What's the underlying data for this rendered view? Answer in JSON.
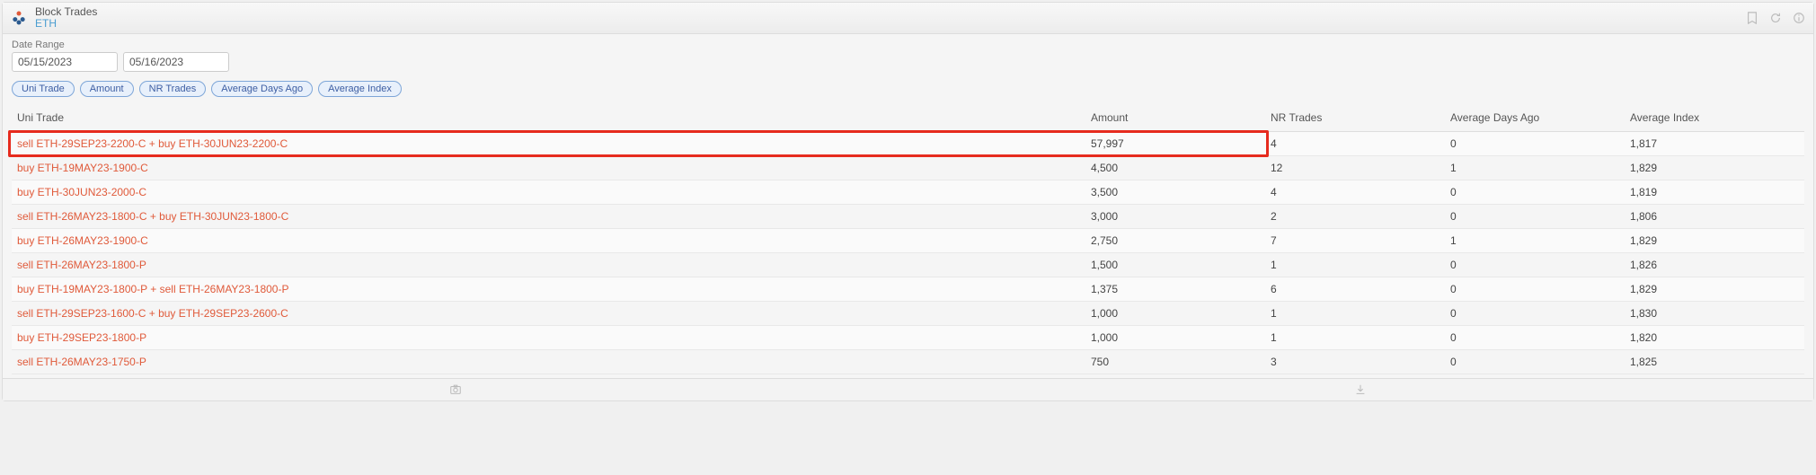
{
  "header": {
    "title": "Block Trades",
    "subtitle": "ETH"
  },
  "date_range": {
    "label": "Date Range",
    "from": "05/15/2023",
    "to": "05/16/2023"
  },
  "chips": [
    "Uni Trade",
    "Amount",
    "NR Trades",
    "Average Days Ago",
    "Average Index"
  ],
  "columns": {
    "c0": "Uni Trade",
    "c1": "Amount",
    "c2": "NR Trades",
    "c3": "Average Days Ago",
    "c4": "Average Index"
  },
  "rows": [
    {
      "trade": "sell ETH-29SEP23-2200-C + buy ETH-30JUN23-2200-C",
      "amount": "57,997",
      "nr": "4",
      "days": "0",
      "index": "1,817",
      "highlight": true
    },
    {
      "trade": "buy ETH-19MAY23-1900-C",
      "amount": "4,500",
      "nr": "12",
      "days": "1",
      "index": "1,829"
    },
    {
      "trade": "buy ETH-30JUN23-2000-C",
      "amount": "3,500",
      "nr": "4",
      "days": "0",
      "index": "1,819"
    },
    {
      "trade": "sell ETH-26MAY23-1800-C + buy ETH-30JUN23-1800-C",
      "amount": "3,000",
      "nr": "2",
      "days": "0",
      "index": "1,806"
    },
    {
      "trade": "buy ETH-26MAY23-1900-C",
      "amount": "2,750",
      "nr": "7",
      "days": "1",
      "index": "1,829"
    },
    {
      "trade": "sell ETH-26MAY23-1800-P",
      "amount": "1,500",
      "nr": "1",
      "days": "0",
      "index": "1,826"
    },
    {
      "trade": "buy ETH-19MAY23-1800-P + sell ETH-26MAY23-1800-P",
      "amount": "1,375",
      "nr": "6",
      "days": "0",
      "index": "1,829"
    },
    {
      "trade": "sell ETH-29SEP23-1600-C + buy ETH-29SEP23-2600-C",
      "amount": "1,000",
      "nr": "1",
      "days": "0",
      "index": "1,830"
    },
    {
      "trade": "buy ETH-29SEP23-1800-P",
      "amount": "1,000",
      "nr": "1",
      "days": "0",
      "index": "1,820"
    },
    {
      "trade": "sell ETH-26MAY23-1750-P",
      "amount": "750",
      "nr": "3",
      "days": "0",
      "index": "1,825"
    }
  ]
}
